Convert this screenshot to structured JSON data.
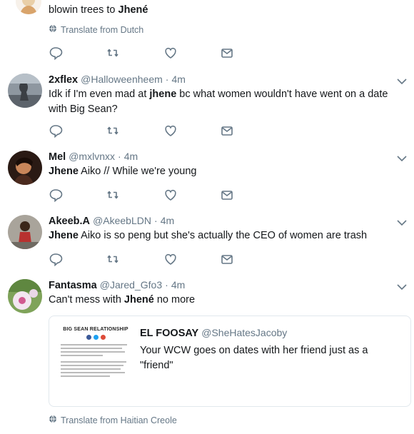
{
  "tweets": [
    {
      "segments": [
        {
          "t": "blowin trees to ",
          "b": false
        },
        {
          "t": "Jhené",
          "b": true
        }
      ],
      "translate": "Translate from Dutch"
    },
    {
      "name": "2xflex",
      "handle": "@Halloweenheem",
      "sep": "·",
      "time": "4m",
      "segments": [
        {
          "t": "Idk if I'm even mad at ",
          "b": false
        },
        {
          "t": "jhene",
          "b": true
        },
        {
          "t": " bc what women wouldn't have went on a date with Big Sean?",
          "b": false
        }
      ]
    },
    {
      "name": "Mel",
      "handle": "@mxlvnxx",
      "sep": "·",
      "time": "4m",
      "segments": [
        {
          "t": "Jhene",
          "b": true
        },
        {
          "t": " Aiko // While we're young",
          "b": false
        }
      ]
    },
    {
      "name": "Akeeb.A",
      "handle": "@AkeebLDN",
      "sep": "·",
      "time": "4m",
      "segments": [
        {
          "t": "Jhene",
          "b": true
        },
        {
          "t": " Aiko is so peng but she's actually the CEO of women are trash",
          "b": false
        }
      ]
    },
    {
      "name": "Fantasma",
      "handle": "@Jared_Gfo3",
      "sep": "·",
      "time": "4m",
      "segments": [
        {
          "t": "Can't mess with ",
          "b": false
        },
        {
          "t": "Jhené",
          "b": true
        },
        {
          "t": " no more",
          "b": false
        }
      ],
      "quote": {
        "name": "EL FOOSAY",
        "handle": "@SheHatesJacoby",
        "text": "Your WCW goes on dates with her friend just as a \"friend\"",
        "image_title": "BIG SEAN RELATIONSHIP"
      },
      "translate": "Translate from Haitian Creole"
    }
  ],
  "icons": {
    "reply": "reply-icon",
    "retweet": "retweet-icon",
    "like": "heart-icon",
    "dm": "envelope-icon",
    "caret": "chevron-down-icon",
    "globe": "globe-icon"
  },
  "colors": {
    "icon": "#657786",
    "border": "#e6ecf0",
    "text": "#14171a"
  }
}
